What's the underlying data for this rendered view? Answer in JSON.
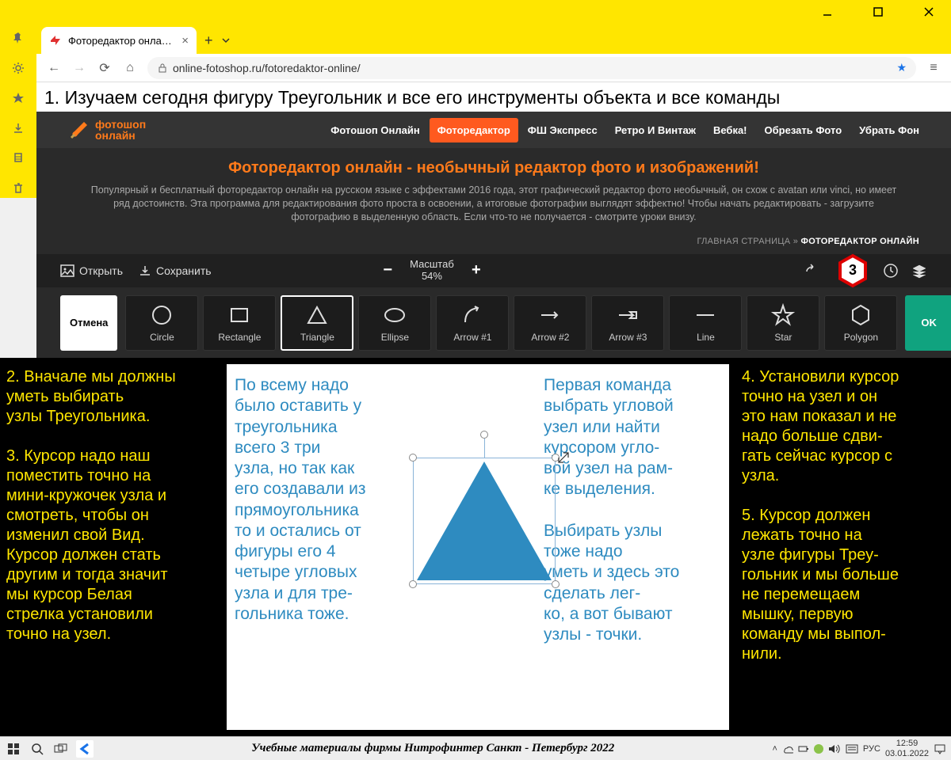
{
  "window": {
    "tab_title": "Фоторедактор онлайн с",
    "url": "online-fotoshop.ru/fotoredaktor-online/"
  },
  "lesson_heading": "1. Изучаем сегодня фигуру Треугольник и все его инструменты объекта и все команды",
  "brand": {
    "line1": "фотошоп",
    "line2": "онлайн"
  },
  "nav": {
    "items": [
      "Фотошоп Онлайн",
      "Фоторедактор",
      "ФШ Экспресс",
      "Ретро И Винтаж",
      "Вебка!",
      "Обрезать Фото",
      "Убрать Фон"
    ],
    "active": 1
  },
  "hero": {
    "title": "Фоторедактор онлайн - необычный редактор фото и изображений!",
    "text": "Популярный и бесплатный фоторедактор онлайн на русском языке с эффектами 2016 года, этот графический редактор фото необычный, он схож с avatan или vinci, но имеет ряд достоинств. Эта программа для редактирования фото проста в освоении, а итоговые фотографии выглядят эффектно! Чтобы начать редактировать - загрузите фотографию в выделенную область. Если что-то не получается - смотрите уроки внизу."
  },
  "breadcrumb": {
    "home": "ГЛАВНАЯ СТРАНИЦА",
    "sep": "»",
    "current": "ФОТОРЕДАКТОР ОНЛАЙН"
  },
  "toolbar": {
    "open": "Открыть",
    "save": "Сохранить",
    "scale_label": "Масштаб",
    "scale_value": "54%",
    "badge": "3"
  },
  "shapes": {
    "cancel": "Отмена",
    "ok": "OK",
    "items": [
      {
        "id": "circle",
        "label": "Circle"
      },
      {
        "id": "rectangle",
        "label": "Rectangle"
      },
      {
        "id": "triangle",
        "label": "Triangle"
      },
      {
        "id": "ellipse",
        "label": "Ellipse"
      },
      {
        "id": "arrow1",
        "label": "Arrow #1"
      },
      {
        "id": "arrow2",
        "label": "Arrow #2"
      },
      {
        "id": "arrow3",
        "label": "Arrow #3"
      },
      {
        "id": "line",
        "label": "Line"
      },
      {
        "id": "star",
        "label": "Star"
      },
      {
        "id": "polygon",
        "label": "Polygon"
      }
    ],
    "selected": 2
  },
  "left_text": "2. Вначале мы должны\n    уметь выбирать\nузлы Треугольника.\n\n3. Курсор надо наш\n   поместить точно на\nмини-кружочек узла и\nсмотреть, чтобы он\nизменил свой Вид.\nКурсор должен стать\nдругим и тогда значит\nмы курсор Белая\nстрелка установили\nточно на узел.",
  "right_text": "4. Установили курсор\n   точно на узел и он\nэто нам показал и не\nнадо больше сдви-\nгать сейчас курсор с\nузла.\n\n5. Курсор должен\n    лежать точно на\nузле фигуры Треу-\nгольник и мы больше\nне перемещаем\nмышку, первую\nкоманду мы выпол-\nнили.",
  "blue_text1": "По всему надо\nбыло оставить у\nтреугольника\nвсего 3 три\nузла, но так как\nего создавали из\nпрямоугольника\nто и остались от\nфигуры его 4\nчетыре угловых\nузла и для тре-\nгольника тоже.",
  "blue_text2": "Первая команда\nвыбрать угловой\nузел или найти\nкурсором угло-\nвой узел на рам-\nке выделения.\n\nВыбирать узлы\n  тоже надо\nуметь и здесь это\nсделать лег-\nко, а вот бывают\nузлы - точки.",
  "taskbar": {
    "text": "Учебные материалы фирмы Нитрофинтер  Санкт - Петербург  2022",
    "lang": "РУС",
    "time": "12:59",
    "date": "03.01.2022"
  }
}
